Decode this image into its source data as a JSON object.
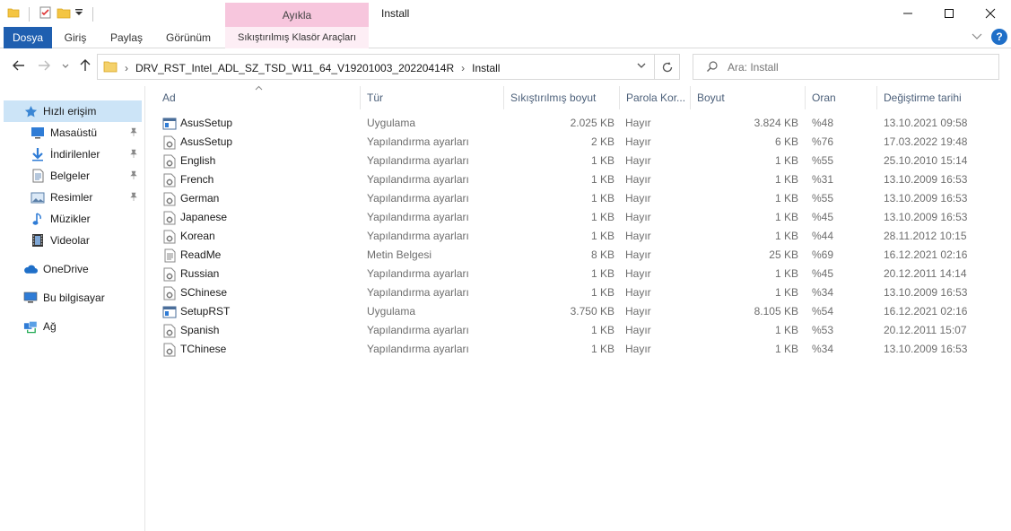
{
  "window": {
    "context_tab": "Ayıkla",
    "title": "Install"
  },
  "ribbon": {
    "tabs": [
      "Dosya",
      "Giriş",
      "Paylaş",
      "Görünüm"
    ],
    "context_tool": "Sıkıştırılmış Klasör Araçları"
  },
  "address": {
    "crumbs": [
      "DRV_RST_Intel_ADL_SZ_TSD_W11_64_V19201003_20220414R",
      "Install"
    ]
  },
  "search": {
    "placeholder": "Ara: Install"
  },
  "sidebar": {
    "items": [
      {
        "label": "Hızlı erişim",
        "icon": "star-icon",
        "pinned": false
      },
      {
        "label": "Masaüstü",
        "icon": "desktop-icon",
        "pinned": true
      },
      {
        "label": "İndirilenler",
        "icon": "download-icon",
        "pinned": true
      },
      {
        "label": "Belgeler",
        "icon": "documents-icon",
        "pinned": true
      },
      {
        "label": "Resimler",
        "icon": "pictures-icon",
        "pinned": true
      },
      {
        "label": "Müzikler",
        "icon": "music-icon",
        "pinned": false
      },
      {
        "label": "Videolar",
        "icon": "video-icon",
        "pinned": false
      },
      {
        "label": "OneDrive",
        "icon": "cloud-icon",
        "pinned": false
      },
      {
        "label": "Bu bilgisayar",
        "icon": "computer-icon",
        "pinned": false
      },
      {
        "label": "Ağ",
        "icon": "network-icon",
        "pinned": false
      }
    ]
  },
  "columns": [
    "Ad",
    "Tür",
    "Sıkıştırılmış boyut",
    "Parola Kor...",
    "Boyut",
    "Oran",
    "Değiştirme tarihi"
  ],
  "files": [
    {
      "name": "AsusSetup",
      "type": "Uygulama",
      "compressed": "2.025 KB",
      "password": "Hayır",
      "size": "3.824 KB",
      "ratio": "%48",
      "modified": "13.10.2021 09:58",
      "kind": "app"
    },
    {
      "name": "AsusSetup",
      "type": "Yapılandırma ayarları",
      "compressed": "2 KB",
      "password": "Hayır",
      "size": "6 KB",
      "ratio": "%76",
      "modified": "17.03.2022 19:48",
      "kind": "ini"
    },
    {
      "name": "English",
      "type": "Yapılandırma ayarları",
      "compressed": "1 KB",
      "password": "Hayır",
      "size": "1 KB",
      "ratio": "%55",
      "modified": "25.10.2010 15:14",
      "kind": "ini"
    },
    {
      "name": "French",
      "type": "Yapılandırma ayarları",
      "compressed": "1 KB",
      "password": "Hayır",
      "size": "1 KB",
      "ratio": "%31",
      "modified": "13.10.2009 16:53",
      "kind": "ini"
    },
    {
      "name": "German",
      "type": "Yapılandırma ayarları",
      "compressed": "1 KB",
      "password": "Hayır",
      "size": "1 KB",
      "ratio": "%55",
      "modified": "13.10.2009 16:53",
      "kind": "ini"
    },
    {
      "name": "Japanese",
      "type": "Yapılandırma ayarları",
      "compressed": "1 KB",
      "password": "Hayır",
      "size": "1 KB",
      "ratio": "%45",
      "modified": "13.10.2009 16:53",
      "kind": "ini"
    },
    {
      "name": "Korean",
      "type": "Yapılandırma ayarları",
      "compressed": "1 KB",
      "password": "Hayır",
      "size": "1 KB",
      "ratio": "%44",
      "modified": "28.11.2012 10:15",
      "kind": "ini"
    },
    {
      "name": "ReadMe",
      "type": "Metin Belgesi",
      "compressed": "8 KB",
      "password": "Hayır",
      "size": "25 KB",
      "ratio": "%69",
      "modified": "16.12.2021 02:16",
      "kind": "txt"
    },
    {
      "name": "Russian",
      "type": "Yapılandırma ayarları",
      "compressed": "1 KB",
      "password": "Hayır",
      "size": "1 KB",
      "ratio": "%45",
      "modified": "20.12.2011 14:14",
      "kind": "ini"
    },
    {
      "name": "SChinese",
      "type": "Yapılandırma ayarları",
      "compressed": "1 KB",
      "password": "Hayır",
      "size": "1 KB",
      "ratio": "%34",
      "modified": "13.10.2009 16:53",
      "kind": "ini"
    },
    {
      "name": "SetupRST",
      "type": "Uygulama",
      "compressed": "3.750 KB",
      "password": "Hayır",
      "size": "8.105 KB",
      "ratio": "%54",
      "modified": "16.12.2021 02:16",
      "kind": "app"
    },
    {
      "name": "Spanish",
      "type": "Yapılandırma ayarları",
      "compressed": "1 KB",
      "password": "Hayır",
      "size": "1 KB",
      "ratio": "%53",
      "modified": "20.12.2011 15:07",
      "kind": "ini"
    },
    {
      "name": "TChinese",
      "type": "Yapılandırma ayarları",
      "compressed": "1 KB",
      "password": "Hayır",
      "size": "1 KB",
      "ratio": "%34",
      "modified": "13.10.2009 16:53",
      "kind": "ini"
    }
  ],
  "colors": {
    "accent": "#1f5fb0",
    "context": "#f7c6dd",
    "selection": "#cce4f7",
    "header_text": "#4c607a"
  }
}
